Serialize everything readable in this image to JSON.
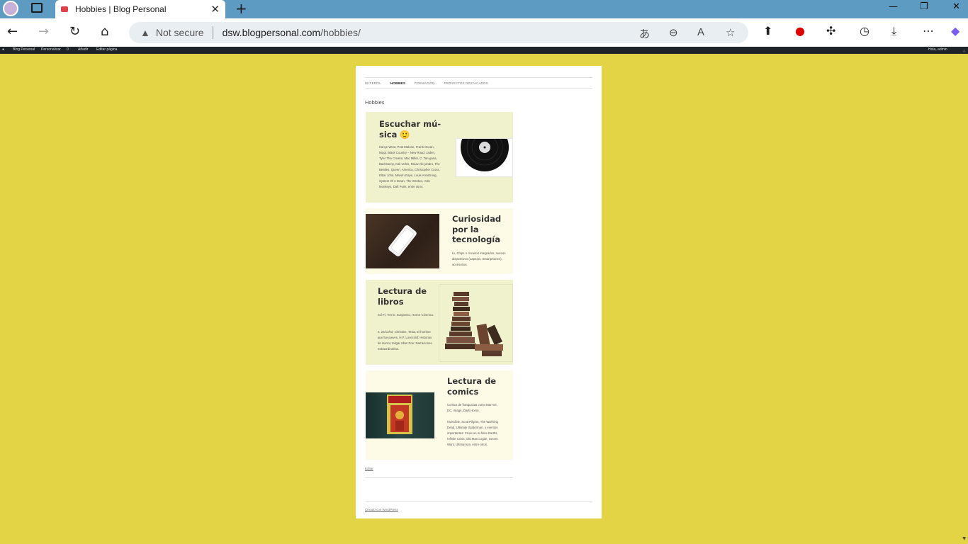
{
  "browser": {
    "tab_title": "Hobbies | Blog Personal",
    "not_secure": "Not secure",
    "url_host": "dsw.blogpersonal.com",
    "url_path": "/hobbies/"
  },
  "wp_admin_bar": {
    "site": "Blog Personal",
    "customize": "Personalizar",
    "comments": "0",
    "new": "Añadir",
    "edit_page": "Editar página",
    "greeting": "Hola, admin"
  },
  "menu": {
    "items": [
      "Mi perfil",
      "Hobbies",
      "Formación",
      "Proyectos destacados"
    ]
  },
  "page_title": "Hobbies",
  "hobbies": [
    {
      "title": "Escuchar mú-sica 🙂",
      "text": "Kanye West, Post Malone, Frank Ocean, Niqqi, Black Country – New Road, Jaden, Tyler The Creator, Mac Miller, C. Tan-gana, Bad Bunny, Kali Uchis, Rauw Ale-jandro, The Beatles, Queen, America, Christopher Cross, Elton John, Marvin Gaye, Louis Armstrong, System Of A Down, The Strokes, Artic Monkeys, Daft Punk, entre otros.",
      "image": "vinyl-record"
    },
    {
      "title": "Curiosidad por la tecnología",
      "text": "IA, Chips o circuitos integrados, nuevos dispositivos (Laptops, Smartphones), accesorios.",
      "image": "smartphone-on-wood"
    },
    {
      "title": "Lectura de libros",
      "text": "Sci-Fi, Terror, Suspenso, Horror Cósmico.",
      "text2": "It, 22/11/63, Christine, Tesla, El hombre que fue jueves, H.P. Lovecraft: Historias de Horror, Edgar Allan Poe: Narraciones Extraordinarias.",
      "image": "book-stack"
    },
    {
      "title": "Lectura de comics",
      "text": "Comics de franquicias como Mar-vel, DC, Image, Dark Horse.",
      "text2": "Invincible, Scott Pilgrim, The Wal-king Dead, Ultimate Spiderman, o eventos importantes: Crisis on In-finite Earths, Infinite Crisis, Old Man Logan, Secret Wars, Ultima-tum, entre otros.",
      "image": "iron-man-comic"
    }
  ],
  "edit_link": "Editar",
  "footer": "Creado con WordPress",
  "colors": {
    "page_bg": "#e2d444",
    "card_green": "#f0f2cd",
    "card_cream": "#fdfbe6",
    "tabbar": "#5e9bc2"
  }
}
